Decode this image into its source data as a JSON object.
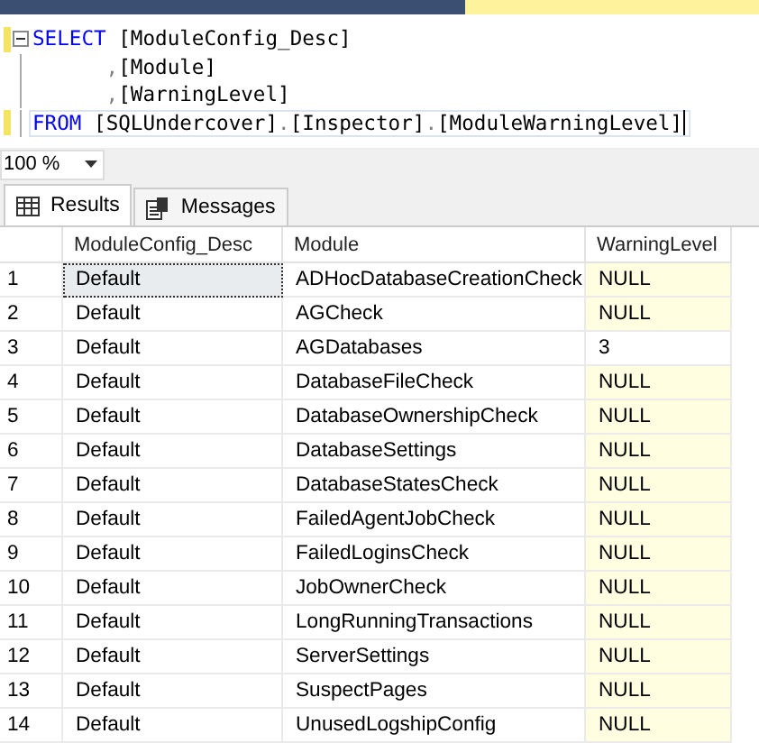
{
  "editor": {
    "lines": [
      {
        "collapsible": true,
        "changed": true,
        "current": false,
        "tokens": [
          {
            "kind": "keyword",
            "text": "SELECT"
          },
          {
            "kind": "ident",
            "text": " [ModuleConfig_Desc]"
          }
        ]
      },
      {
        "collapsible": false,
        "changed": false,
        "current": false,
        "tokens": [
          {
            "kind": "punct",
            "text": "      ,"
          },
          {
            "kind": "ident",
            "text": "[Module]"
          }
        ]
      },
      {
        "collapsible": false,
        "changed": false,
        "current": false,
        "tokens": [
          {
            "kind": "punct",
            "text": "      ,"
          },
          {
            "kind": "ident",
            "text": "[WarningLevel]"
          }
        ]
      },
      {
        "collapsible": false,
        "changed": true,
        "current": true,
        "tokens": [
          {
            "kind": "keyword",
            "text": "FROM"
          },
          {
            "kind": "ident",
            "text": " [SQLUndercover]"
          },
          {
            "kind": "punct",
            "text": "."
          },
          {
            "kind": "ident",
            "text": "[Inspector]"
          },
          {
            "kind": "punct",
            "text": "."
          },
          {
            "kind": "ident",
            "text": "[ModuleWarningLevel]"
          }
        ]
      }
    ]
  },
  "zoom": {
    "value": "100 %"
  },
  "result_tabs": [
    {
      "label": "Results",
      "selected": true,
      "kind": "grid"
    },
    {
      "label": "Messages",
      "selected": false,
      "kind": "messages"
    }
  ],
  "grid": {
    "columns": [
      "ModuleConfig_Desc",
      "Module",
      "WarningLevel"
    ],
    "rows": [
      {
        "number": "1",
        "desc": "Default",
        "module": "ADHocDatabaseCreationCheck",
        "warning_level": "NULL",
        "is_null": true,
        "selected": true
      },
      {
        "number": "2",
        "desc": "Default",
        "module": "AGCheck",
        "warning_level": "NULL",
        "is_null": true,
        "selected": false
      },
      {
        "number": "3",
        "desc": "Default",
        "module": "AGDatabases",
        "warning_level": "3",
        "is_null": false,
        "selected": false
      },
      {
        "number": "4",
        "desc": "Default",
        "module": "DatabaseFileCheck",
        "warning_level": "NULL",
        "is_null": true,
        "selected": false
      },
      {
        "number": "5",
        "desc": "Default",
        "module": "DatabaseOwnershipCheck",
        "warning_level": "NULL",
        "is_null": true,
        "selected": false
      },
      {
        "number": "6",
        "desc": "Default",
        "module": "DatabaseSettings",
        "warning_level": "NULL",
        "is_null": true,
        "selected": false
      },
      {
        "number": "7",
        "desc": "Default",
        "module": "DatabaseStatesCheck",
        "warning_level": "NULL",
        "is_null": true,
        "selected": false
      },
      {
        "number": "8",
        "desc": "Default",
        "module": "FailedAgentJobCheck",
        "warning_level": "NULL",
        "is_null": true,
        "selected": false
      },
      {
        "number": "9",
        "desc": "Default",
        "module": "FailedLoginsCheck",
        "warning_level": "NULL",
        "is_null": true,
        "selected": false
      },
      {
        "number": "10",
        "desc": "Default",
        "module": "JobOwnerCheck",
        "warning_level": "NULL",
        "is_null": true,
        "selected": false
      },
      {
        "number": "11",
        "desc": "Default",
        "module": "LongRunningTransactions",
        "warning_level": "NULL",
        "is_null": true,
        "selected": false
      },
      {
        "number": "12",
        "desc": "Default",
        "module": "ServerSettings",
        "warning_level": "NULL",
        "is_null": true,
        "selected": false
      },
      {
        "number": "13",
        "desc": "Default",
        "module": "SuspectPages",
        "warning_level": "NULL",
        "is_null": true,
        "selected": false
      },
      {
        "number": "14",
        "desc": "Default",
        "module": "UnusedLogshipConfig",
        "warning_level": "NULL",
        "is_null": true,
        "selected": false
      }
    ]
  }
}
